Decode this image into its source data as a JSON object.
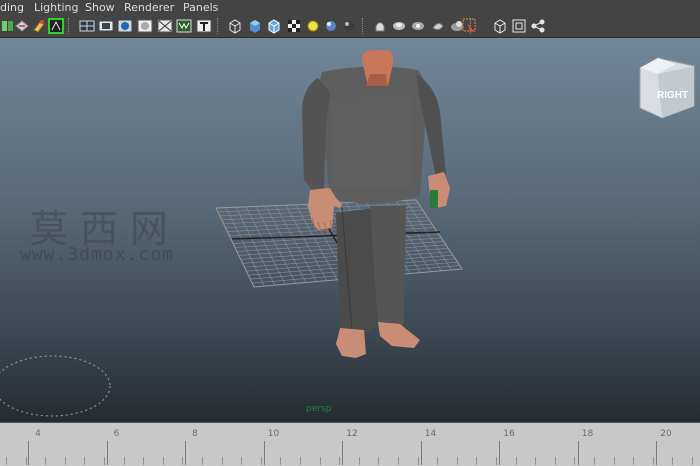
{
  "menubar": {
    "items": [
      "ding",
      "Lighting",
      "Show",
      "Renderer",
      "Panels"
    ]
  },
  "toolbar": {
    "icons": [
      "select-camera-icon",
      "lock-camera-icon",
      "bookmark-icon",
      "image-plane-icon",
      "grid-toggle-icon",
      "film-gate-icon",
      "resolution-gate-icon",
      "gate-mask-icon",
      "field-chart-icon",
      "safe-action-icon",
      "safe-title-icon",
      "wireframe-icon",
      "smooth-shade-icon",
      "wireframe-on-shaded-icon",
      "textured-icon",
      "use-default-light-icon",
      "all-lights-icon",
      "shadows-icon",
      "isolate-select-icon",
      "xray-icon",
      "xray-joints-icon",
      "xray-components-icon",
      "highlight-select-icon",
      "backface-culling-icon",
      "smooth-wireframe-icon",
      "node-editor-icon"
    ]
  },
  "viewport": {
    "camera_label": "persp",
    "viewcube_label": "RIGHT",
    "watermark_cn": "莫西网",
    "watermark_url": "www.3dmox.com"
  },
  "timeline": {
    "labels": [
      "4",
      "6",
      "8",
      "10",
      "12",
      "14",
      "16",
      "18",
      "20"
    ]
  },
  "colors": {
    "viewport_top": "#71879a",
    "viewport_bottom": "#262b31",
    "timeline_bg": "#c8c8c8",
    "camera_label": "#1a8a3a"
  }
}
